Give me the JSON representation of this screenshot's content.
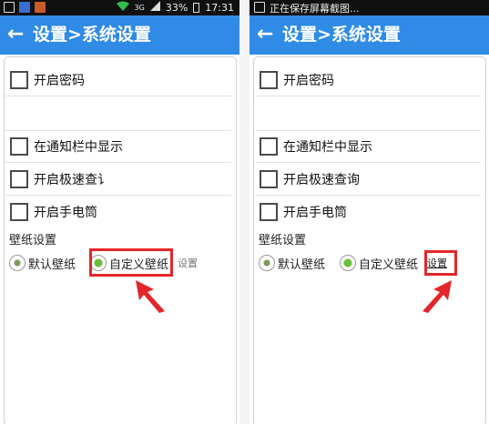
{
  "colors": {
    "statusbar": "#101010",
    "appbar": "#2f8be6",
    "highlight": "#e3262a"
  },
  "left": {
    "statusbar": {
      "signal": "3G",
      "battery": "33%",
      "time": "17:31"
    },
    "header": {
      "back_icon": "back-arrow-icon",
      "title": "设置>系统设置"
    },
    "options": [
      {
        "label": "开启密码",
        "checked": false
      },
      {
        "label": "在通知栏中显示",
        "checked": false
      },
      {
        "label": "开启极速查讠",
        "checked": false
      },
      {
        "label": "开启手电筒",
        "checked": false
      }
    ],
    "wallpaper": {
      "title": "壁纸设置",
      "options": [
        {
          "label": "默认壁纸",
          "selected": false
        },
        {
          "label": "自定义壁纸",
          "selected": true
        }
      ],
      "set_link": "设置"
    }
  },
  "right": {
    "statusbar": {
      "notice": "正在保存屏幕截图..."
    },
    "header": {
      "back_icon": "back-arrow-icon",
      "title": "设置>系统设置"
    },
    "options": [
      {
        "label": "开启密码",
        "checked": false
      },
      {
        "label": "在通知栏中显示",
        "checked": false
      },
      {
        "label": "开启极速查询",
        "checked": false
      },
      {
        "label": "开启手电筒",
        "checked": false
      }
    ],
    "wallpaper": {
      "title": "壁纸设置",
      "options": [
        {
          "label": "默认壁纸",
          "selected": false
        },
        {
          "label": "自定义壁纸",
          "selected": true
        }
      ],
      "set_link": "设置"
    }
  }
}
